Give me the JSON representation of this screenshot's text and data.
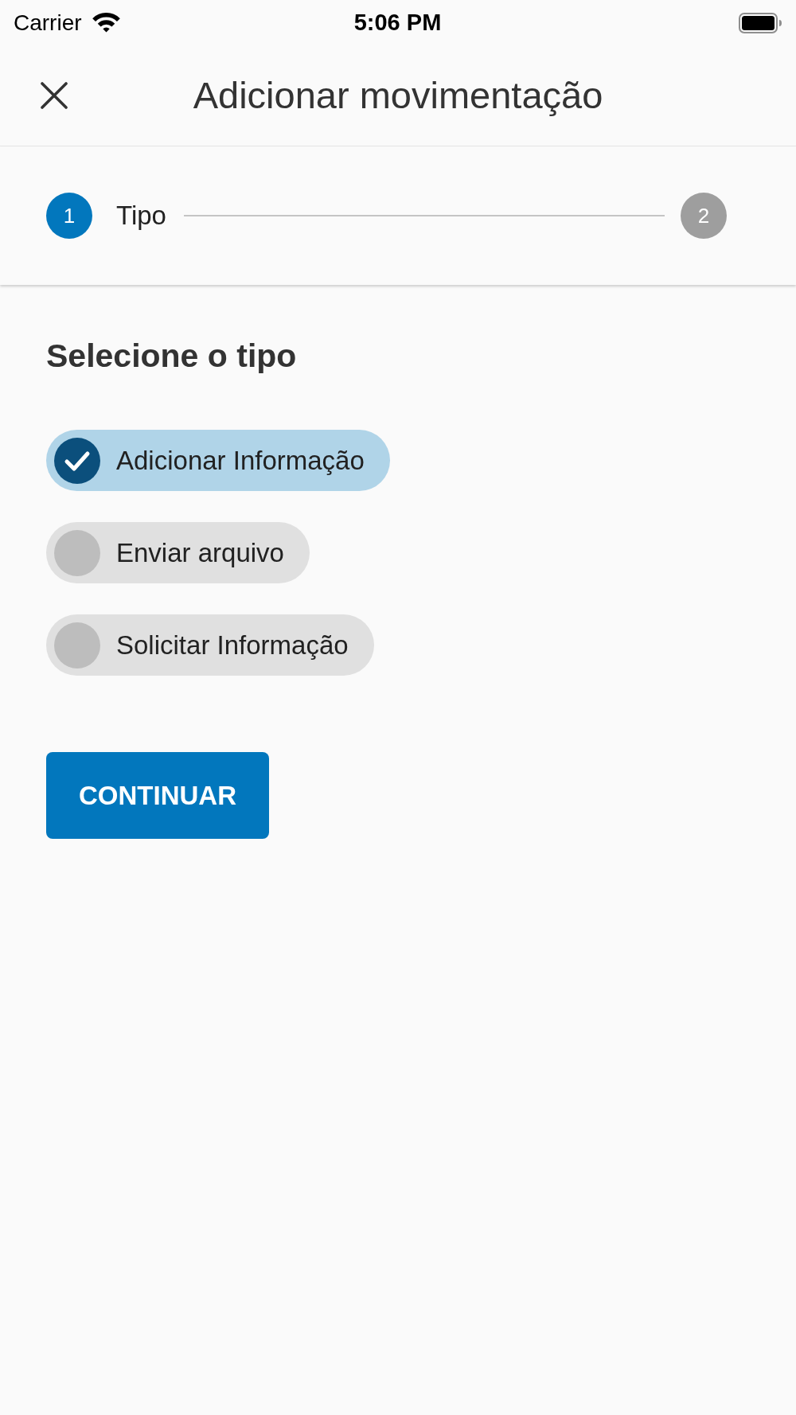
{
  "status_bar": {
    "carrier": "Carrier",
    "time": "5:06 PM"
  },
  "header": {
    "title": "Adicionar movimentação"
  },
  "stepper": {
    "steps": [
      {
        "number": "1",
        "label": "Tipo",
        "active": true
      },
      {
        "number": "2",
        "active": false
      }
    ]
  },
  "section": {
    "heading": "Selecione o tipo",
    "options": [
      {
        "label": "Adicionar Informação",
        "selected": true
      },
      {
        "label": "Enviar arquivo",
        "selected": false
      },
      {
        "label": "Solicitar Informação",
        "selected": false
      }
    ]
  },
  "continue_button": {
    "label": "CONTINUAR"
  }
}
